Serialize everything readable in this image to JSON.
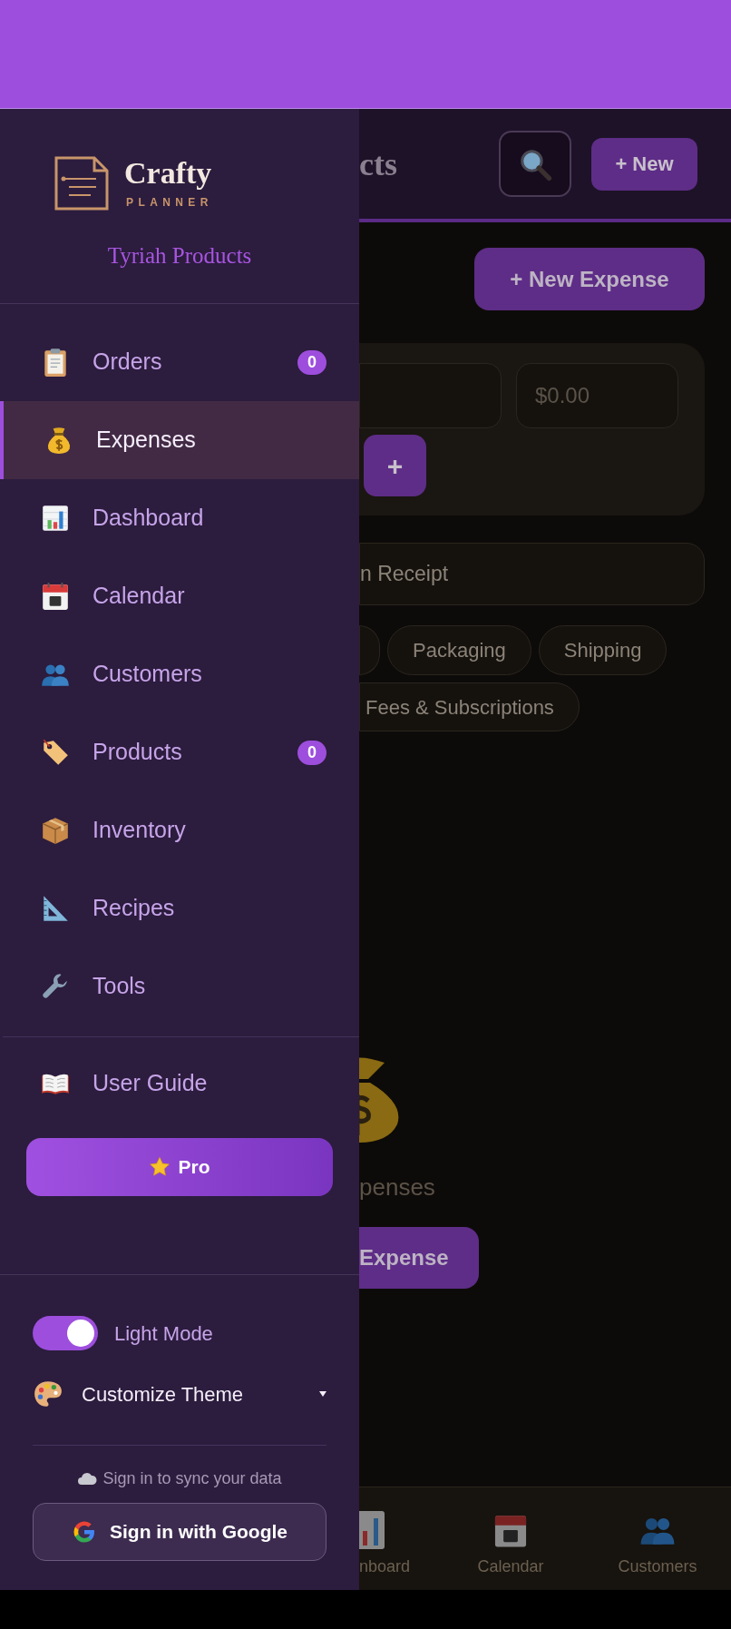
{
  "drawer": {
    "logo": {
      "title": "Crafty",
      "subtitle": "PLANNER"
    },
    "business_name": "Tyriah Products",
    "menu": [
      {
        "label": "Orders",
        "badge": "0",
        "selected": false
      },
      {
        "label": "Expenses",
        "selected": true
      },
      {
        "label": "Dashboard",
        "selected": false
      },
      {
        "label": "Calendar",
        "selected": false
      },
      {
        "label": "Customers",
        "selected": false
      },
      {
        "label": "Products",
        "badge": "0",
        "selected": false
      },
      {
        "label": "Inventory",
        "selected": false
      },
      {
        "label": "Recipes",
        "selected": false
      },
      {
        "label": "Tools",
        "selected": false
      }
    ],
    "secondary": [
      {
        "label": "User Guide",
        "selected": false
      }
    ],
    "pro_button": "Pro",
    "light_mode": {
      "label": "Light Mode",
      "on": true
    },
    "customize_theme": {
      "label": "Customize Theme",
      "expanded": false
    },
    "sync_text": "Sign in to sync your data",
    "google_button": "Sign in with Google"
  },
  "header": {
    "title": "cts",
    "new_button": "+ New"
  },
  "new_expense_button": "+ New Expense",
  "form": {
    "amount_placeholder": "$0.00",
    "add_button": "+"
  },
  "receipt_button": "n Receipt",
  "categories": [
    {
      "label": "Packaging"
    },
    {
      "label": "Shipping"
    },
    {
      "label": "Fees & Subscriptions"
    }
  ],
  "empty_state": {
    "text": "penses",
    "button": "Expense"
  },
  "bottom_nav": [
    {
      "label": "nboard"
    },
    {
      "label": "Calendar"
    },
    {
      "label": "Customers"
    }
  ]
}
